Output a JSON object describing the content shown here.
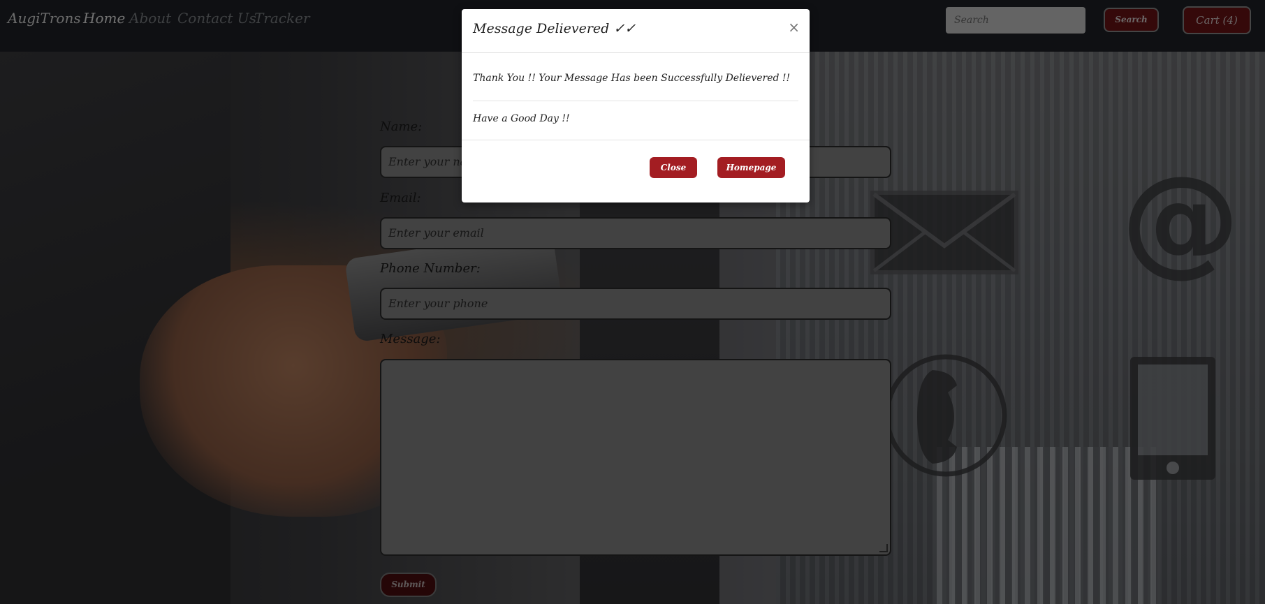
{
  "navbar": {
    "brand": "AugiTrons",
    "links": [
      "Home",
      "About",
      "Contact Us",
      "Tracker"
    ],
    "search_placeholder": "Search",
    "search_button": "Search",
    "cart_label": "Cart (4)"
  },
  "form": {
    "name_label": "Name:",
    "name_placeholder": "Enter your name",
    "email_label": "Email:",
    "email_placeholder": "Enter your email",
    "phone_label": "Phone Number:",
    "phone_placeholder": "Enter your phone",
    "message_label": "Message:",
    "submit_label": "Submit"
  },
  "modal": {
    "title": "Message Delievered ✓✓",
    "close_glyph": "×",
    "line1": "Thank You !! Your Message Has been Successfully Delievered !!",
    "line2": "Have a Good Day !!",
    "close_button": "Close",
    "homepage_button": "Homepage"
  },
  "colors": {
    "navbar_bg": "#1e2126",
    "accent_red": "#a31d22",
    "dark_red": "#6a1215"
  },
  "icons": [
    "envelope-icon",
    "at-sign-icon",
    "telephone-icon",
    "tablet-icon"
  ]
}
